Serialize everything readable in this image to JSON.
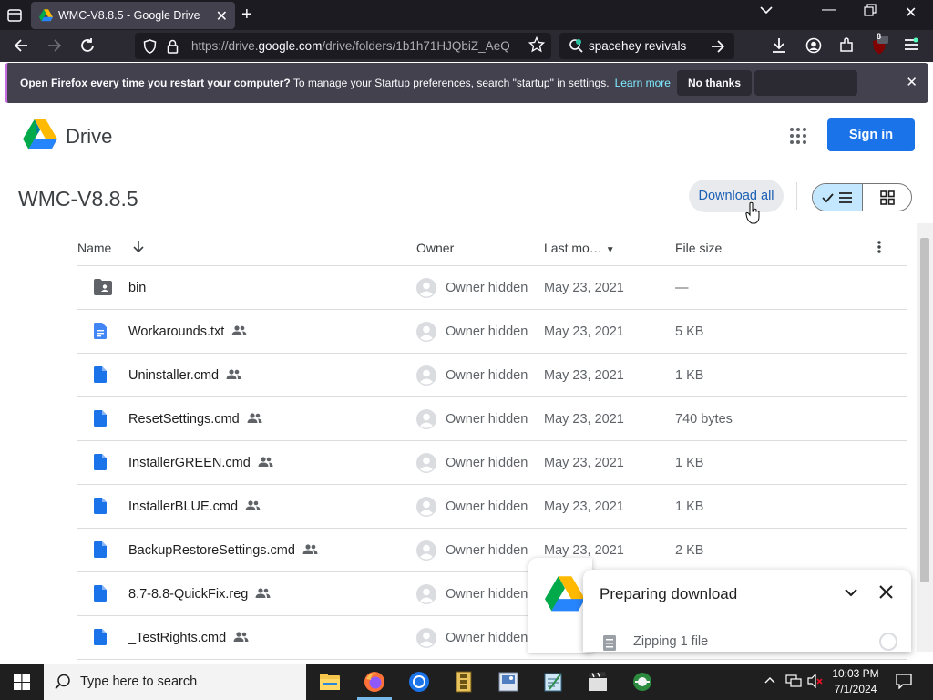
{
  "browser": {
    "tab_title": "WMC-V8.8.5 - Google Drive",
    "url_prefix": "https://drive.",
    "url_domain": "google.com",
    "url_path": "/drive/folders/1b1h71HJQbiZ_AeQ",
    "search_text": "spacehey revivals",
    "extension_badge": "8"
  },
  "notification": {
    "bold_text": "Open Firefox every time you restart your computer?",
    "text": " To manage your Startup preferences, search \"startup\" in settings.",
    "link": "Learn more",
    "no_thanks": "No thanks"
  },
  "drive": {
    "logo_text": "Drive",
    "sign_in": "Sign in",
    "folder_title": "WMC-V8.8.5",
    "download_all": "Download all",
    "columns": {
      "name": "Name",
      "owner": "Owner",
      "modified": "Last mo…",
      "size": "File size"
    },
    "files": [
      {
        "name": "bin",
        "type": "folder",
        "owner": "Owner hidden",
        "modified": "May 23, 2021",
        "size": "—",
        "shared": false
      },
      {
        "name": "Workarounds.txt",
        "type": "doc",
        "owner": "Owner hidden",
        "modified": "May 23, 2021",
        "size": "5 KB",
        "shared": true
      },
      {
        "name": "Uninstaller.cmd",
        "type": "file",
        "owner": "Owner hidden",
        "modified": "May 23, 2021",
        "size": "1 KB",
        "shared": true
      },
      {
        "name": "ResetSettings.cmd",
        "type": "file",
        "owner": "Owner hidden",
        "modified": "May 23, 2021",
        "size": "740 bytes",
        "shared": true
      },
      {
        "name": "InstallerGREEN.cmd",
        "type": "file",
        "owner": "Owner hidden",
        "modified": "May 23, 2021",
        "size": "1 KB",
        "shared": true
      },
      {
        "name": "InstallerBLUE.cmd",
        "type": "file",
        "owner": "Owner hidden",
        "modified": "May 23, 2021",
        "size": "1 KB",
        "shared": true
      },
      {
        "name": "BackupRestoreSettings.cmd",
        "type": "file",
        "owner": "Owner hidden",
        "modified": "May 23, 2021",
        "size": "2 KB",
        "shared": true
      },
      {
        "name": "8.7-8.8-QuickFix.reg",
        "type": "file",
        "owner": "Owner hidden",
        "modified": "",
        "size": "",
        "shared": true
      },
      {
        "name": "_TestRights.cmd",
        "type": "file",
        "owner": "Owner hidden",
        "modified": "",
        "size": "",
        "shared": true
      }
    ]
  },
  "download_panel": {
    "title": "Preparing download",
    "item": "Zipping 1 file"
  },
  "taskbar": {
    "search_placeholder": "Type here to search",
    "time": "10:03 PM",
    "date": "7/1/2024"
  },
  "colors": {
    "accent": "#1a73e8",
    "firefox_bg": "#1c1b22",
    "selected_view": "#c2e7ff"
  }
}
